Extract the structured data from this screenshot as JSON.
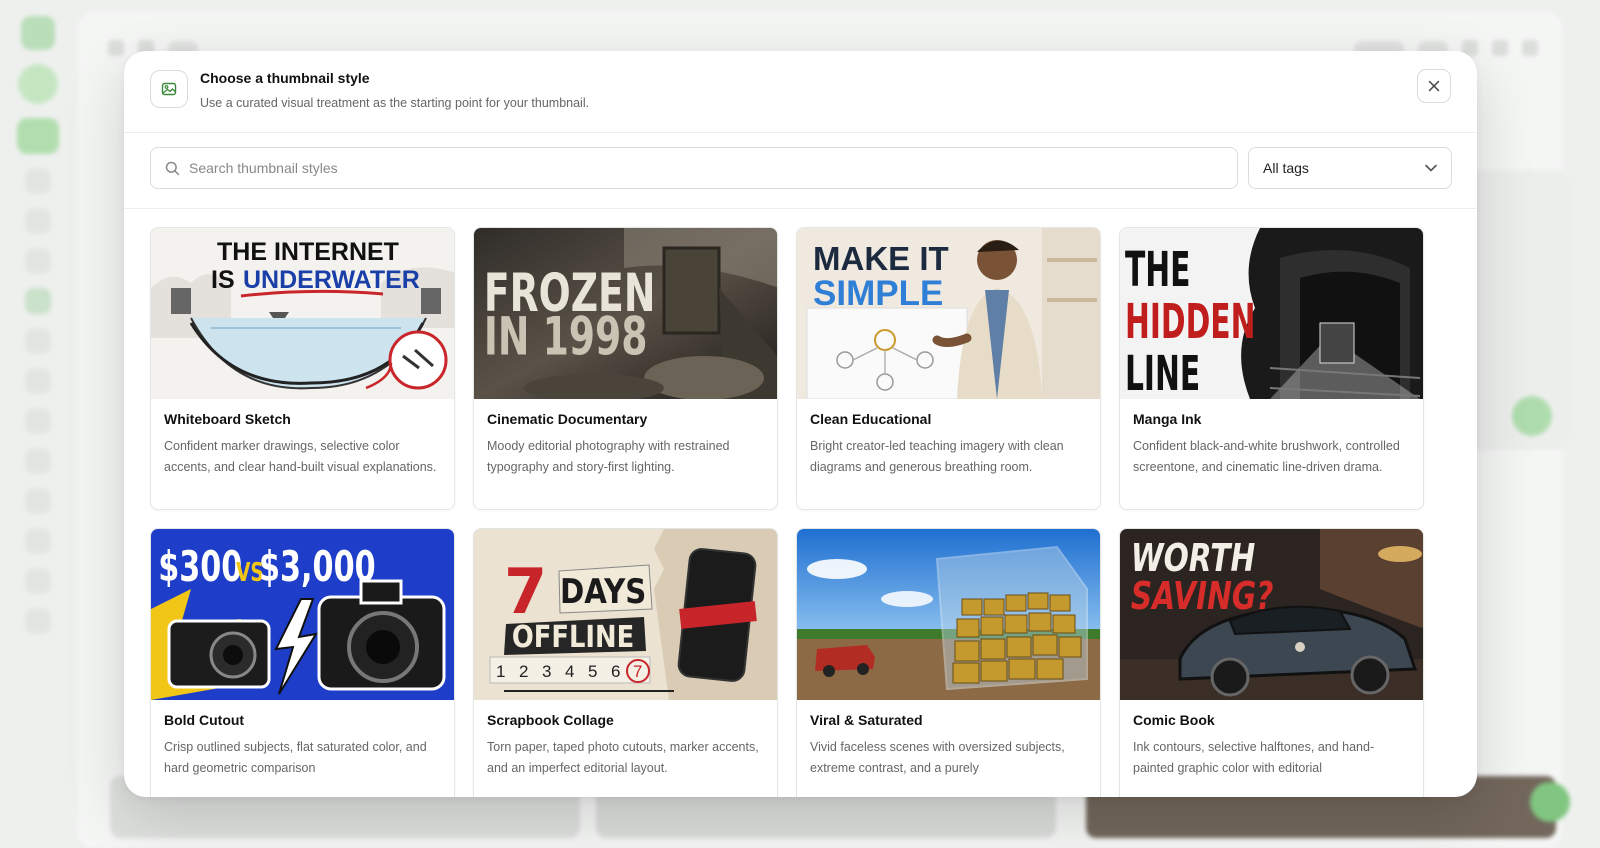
{
  "modal": {
    "title": "Choose a thumbnail style",
    "subtitle": "Use a curated visual treatment as the starting point for your thumbnail.",
    "icon": "image-icon",
    "close_icon": "close-icon"
  },
  "search": {
    "placeholder": "Search thumbnail styles",
    "value": "",
    "icon": "search-icon"
  },
  "tags_filter": {
    "selected": "All tags",
    "icon": "chevron-down-icon"
  },
  "styles": [
    {
      "name": "Whiteboard Sketch",
      "description": "Confident marker drawings, selective color accents, and clear hand-built visual explanations.",
      "thumb_text": [
        "THE INTERNET",
        "IS",
        "UNDERWATER"
      ]
    },
    {
      "name": "Cinematic Documentary",
      "description": "Moody editorial photography with restrained typography and story-first lighting.",
      "thumb_text": [
        "FROZEN",
        "IN 1998"
      ]
    },
    {
      "name": "Clean Educational",
      "description": "Bright creator-led teaching imagery with clean diagrams and generous breathing room.",
      "thumb_text": [
        "MAKE IT",
        "SIMPLE"
      ]
    },
    {
      "name": "Manga Ink",
      "description": "Confident black-and-white brushwork, controlled screentone, and cinematic line-driven drama.",
      "thumb_text": [
        "THE",
        "HIDDEN",
        "LINE"
      ]
    },
    {
      "name": "Bold Cutout",
      "description": "Crisp outlined subjects, flat saturated color, and hard geometric comparison",
      "thumb_text": [
        "$300",
        "VS",
        "$3,000"
      ]
    },
    {
      "name": "Scrapbook Collage",
      "description": "Torn paper, taped photo cutouts, marker accents, and an imperfect editorial layout.",
      "thumb_text": [
        "7",
        "DAYS",
        "OFFLINE",
        "1",
        "2",
        "3",
        "4",
        "5",
        "6",
        "7"
      ]
    },
    {
      "name": "Viral & Saturated",
      "description": "Vivid faceless scenes with oversized subjects, extreme contrast, and a purely",
      "thumb_text": []
    },
    {
      "name": "Comic Book",
      "description": "Ink contours, selective halftones, and hand-painted graphic color with editorial",
      "thumb_text": [
        "WORTH",
        "SAVING?"
      ]
    }
  ]
}
